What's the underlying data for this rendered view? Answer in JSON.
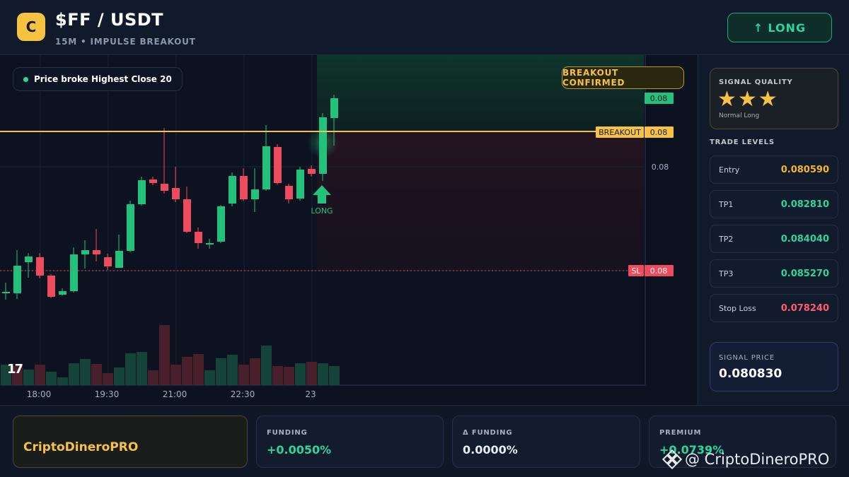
{
  "header": {
    "logo_letter": "C",
    "pair": "$FF / USDT",
    "subtitle": "15M • IMPULSE BREAKOUT",
    "long_button": {
      "arrow": "↑",
      "label": "LONG"
    }
  },
  "chart": {
    "info_text": "Price broke Highest Close 20",
    "badge": "BREAKOUT CONFIRMED",
    "long_marker_label": "LONG",
    "breakout_label": "BREAKOUT",
    "sl_label": "SL",
    "price_tags": {
      "top": "0.08",
      "breakout": "0.08",
      "mid": "0.08",
      "sl": "0.08"
    },
    "time_labels": [
      "18:00",
      "19:30",
      "21:00",
      "22:30",
      "23"
    ],
    "watermark_logo": "17",
    "colors": {
      "up": "#22c27c",
      "down": "#ef4b5f",
      "breakout": "#f5c242",
      "sl": "#ef4b5f"
    }
  },
  "sidebar": {
    "signal_quality_title": "SIGNAL QUALITY",
    "stars": "★★★",
    "signal_quality_sub": "Normal Long",
    "trade_levels_title": "TRADE LEVELS",
    "levels": [
      {
        "label": "Entry",
        "value": "0.080590",
        "color": "#f5b529"
      },
      {
        "label": "TP1",
        "value": "0.082810",
        "color": "#2bd69a"
      },
      {
        "label": "TP2",
        "value": "0.084040",
        "color": "#2bd69a"
      },
      {
        "label": "TP3",
        "value": "0.085270",
        "color": "#2bd69a"
      },
      {
        "label": "Stop Loss",
        "value": "0.078240",
        "color": "#ff5a6e"
      }
    ],
    "signal_price_title": "SIGNAL PRICE",
    "signal_price": "0.080830"
  },
  "footer": {
    "brand": "CriptoDineroPRO",
    "metrics": [
      {
        "label": "FUNDING",
        "value": "+0.0050%",
        "color": "#2bd69a"
      },
      {
        "label": "Δ FUNDING",
        "value": "0.0000%",
        "color": "#e6ecf5"
      },
      {
        "label": "PREMIUM",
        "value": "+0.0739%",
        "color": "#2bd69a"
      }
    ],
    "watermark": "@ CriptoDineroPRO"
  }
}
